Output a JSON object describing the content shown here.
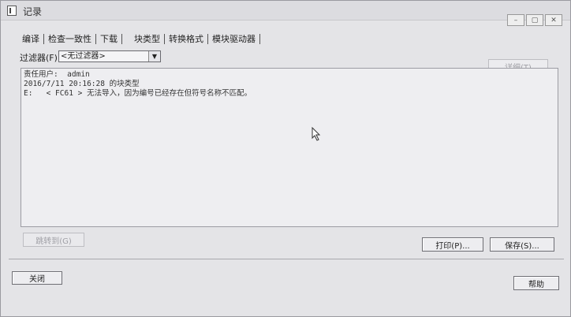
{
  "window": {
    "title": "记录"
  },
  "tabs": [
    {
      "label": "编译"
    },
    {
      "label": "检查一致性"
    },
    {
      "label": "下载"
    },
    {
      "label": "块类型"
    },
    {
      "label": "转换格式"
    },
    {
      "label": "模块驱动器"
    }
  ],
  "filter": {
    "label": "过滤器(F)",
    "selected": "<无过滤器>"
  },
  "buttons": {
    "details": "详细(T)",
    "jump": "跳转到(G)",
    "print": "打印(P)...",
    "save": "保存(S)...",
    "close": "关闭",
    "help": "帮助"
  },
  "log": {
    "lines": [
      "责任用户:  admin",
      "2016/7/11 20:16:28 的块类型",
      "E:   < FC61 > 无法导入，因为编号已经存在但符号名称不匹配。"
    ]
  }
}
